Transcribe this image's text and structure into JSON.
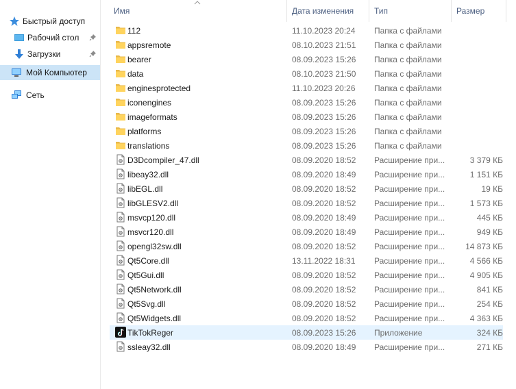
{
  "nav": {
    "quick_access": "Быстрый доступ",
    "desktop": "Рабочий стол",
    "downloads": "Загрузки",
    "this_pc": "Мой Компьютер",
    "network": "Сеть"
  },
  "columns": {
    "name": "Имя",
    "date": "Дата изменения",
    "type": "Тип",
    "size": "Размер"
  },
  "files": [
    {
      "name": "112",
      "date": "11.10.2023 20:24",
      "type": "Папка с файлами",
      "size": "",
      "icon": "folder-icon"
    },
    {
      "name": "appsremote",
      "date": "08.10.2023 21:51",
      "type": "Папка с файлами",
      "size": "",
      "icon": "folder-icon"
    },
    {
      "name": "bearer",
      "date": "08.09.2023 15:26",
      "type": "Папка с файлами",
      "size": "",
      "icon": "folder-icon"
    },
    {
      "name": "data",
      "date": "08.10.2023 21:50",
      "type": "Папка с файлами",
      "size": "",
      "icon": "folder-icon"
    },
    {
      "name": "enginesprotected",
      "date": "11.10.2023 20:26",
      "type": "Папка с файлами",
      "size": "",
      "icon": "folder-icon"
    },
    {
      "name": "iconengines",
      "date": "08.09.2023 15:26",
      "type": "Папка с файлами",
      "size": "",
      "icon": "folder-icon"
    },
    {
      "name": "imageformats",
      "date": "08.09.2023 15:26",
      "type": "Папка с файлами",
      "size": "",
      "icon": "folder-icon"
    },
    {
      "name": "platforms",
      "date": "08.09.2023 15:26",
      "type": "Папка с файлами",
      "size": "",
      "icon": "folder-icon"
    },
    {
      "name": "translations",
      "date": "08.09.2023 15:26",
      "type": "Папка с файлами",
      "size": "",
      "icon": "folder-icon"
    },
    {
      "name": "D3Dcompiler_47.dll",
      "date": "08.09.2020 18:52",
      "type": "Расширение при...",
      "size": "3 379 КБ",
      "icon": "dll-file-icon"
    },
    {
      "name": "libeay32.dll",
      "date": "08.09.2020 18:49",
      "type": "Расширение при...",
      "size": "1 151 КБ",
      "icon": "dll-file-icon"
    },
    {
      "name": "libEGL.dll",
      "date": "08.09.2020 18:52",
      "type": "Расширение при...",
      "size": "19 КБ",
      "icon": "dll-file-icon"
    },
    {
      "name": "libGLESV2.dll",
      "date": "08.09.2020 18:52",
      "type": "Расширение при...",
      "size": "1 573 КБ",
      "icon": "dll-file-icon"
    },
    {
      "name": "msvcp120.dll",
      "date": "08.09.2020 18:49",
      "type": "Расширение при...",
      "size": "445 КБ",
      "icon": "dll-file-icon"
    },
    {
      "name": "msvcr120.dll",
      "date": "08.09.2020 18:49",
      "type": "Расширение при...",
      "size": "949 КБ",
      "icon": "dll-file-icon"
    },
    {
      "name": "opengl32sw.dll",
      "date": "08.09.2020 18:52",
      "type": "Расширение при...",
      "size": "14 873 КБ",
      "icon": "dll-file-icon"
    },
    {
      "name": "Qt5Core.dll",
      "date": "13.11.2022 18:31",
      "type": "Расширение при...",
      "size": "4 566 КБ",
      "icon": "dll-file-icon"
    },
    {
      "name": "Qt5Gui.dll",
      "date": "08.09.2020 18:52",
      "type": "Расширение при...",
      "size": "4 905 КБ",
      "icon": "dll-file-icon"
    },
    {
      "name": "Qt5Network.dll",
      "date": "08.09.2020 18:52",
      "type": "Расширение при...",
      "size": "841 КБ",
      "icon": "dll-file-icon"
    },
    {
      "name": "Qt5Svg.dll",
      "date": "08.09.2020 18:52",
      "type": "Расширение при...",
      "size": "254 КБ",
      "icon": "dll-file-icon"
    },
    {
      "name": "Qt5Widgets.dll",
      "date": "08.09.2020 18:52",
      "type": "Расширение при...",
      "size": "4 363 КБ",
      "icon": "dll-file-icon"
    },
    {
      "name": "TikTokReger",
      "date": "08.09.2023 15:26",
      "type": "Приложение",
      "size": "324 КБ",
      "icon": "tiktok-app-icon",
      "selected": true
    },
    {
      "name": "ssleay32.dll",
      "date": "08.09.2020 18:49",
      "type": "Расширение при...",
      "size": "271 КБ",
      "icon": "dll-file-icon"
    }
  ],
  "colors": {
    "selection": "#cce4f7",
    "hover": "#e5f3ff",
    "folder": "#ffd45e",
    "header_text": "#4d6082"
  }
}
